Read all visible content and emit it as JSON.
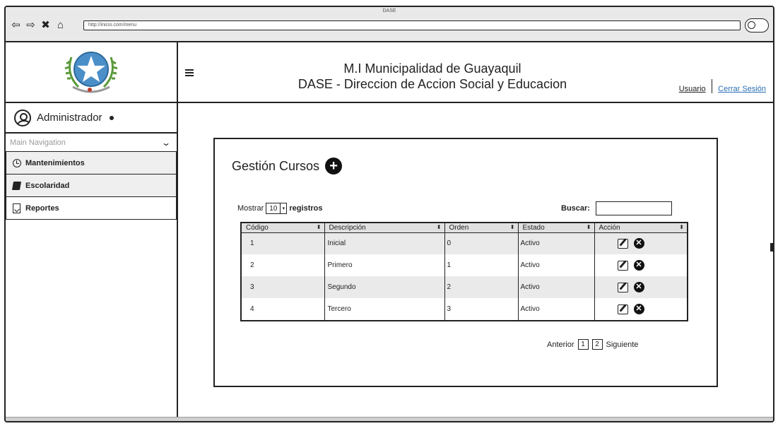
{
  "browser": {
    "window_title": "DASE",
    "url": "http://inicio.com/menu"
  },
  "sidebar": {
    "user_name": "Administrador",
    "main_nav_label": "Main Navigation",
    "items": [
      {
        "label": "Mantenimientos",
        "icon": "clock-icon"
      },
      {
        "label": "Escolaridad",
        "icon": "book-icon"
      },
      {
        "label": "Reportes",
        "icon": "document-icon"
      }
    ]
  },
  "header": {
    "title_line1": "M.I Municipalidad de Guayaquil",
    "title_line2": "DASE - Direccion de Accion Social y Educacion",
    "user_link": "Usuario",
    "logout_link": "Cerrar Sesión"
  },
  "panel": {
    "title": "Gestión Cursos",
    "show_prefix": "Mostrar",
    "show_value": "10",
    "show_suffix": "registros",
    "search_label": "Buscar:",
    "search_value": "",
    "table": {
      "columns": [
        "Código",
        "Descripción",
        "Orden",
        "Estado",
        "Acción"
      ],
      "rows": [
        {
          "codigo": "1",
          "descripcion": "Inicial",
          "orden": "0",
          "estado": "Activo"
        },
        {
          "codigo": "2",
          "descripcion": "Primero",
          "orden": "1",
          "estado": "Activo"
        },
        {
          "codigo": "3",
          "descripcion": "Segundo",
          "orden": "2",
          "estado": "Activo"
        },
        {
          "codigo": "4",
          "descripcion": "Tercero",
          "orden": "3",
          "estado": "Activo"
        }
      ]
    },
    "pagination": {
      "prev_label": "Anterior",
      "pages": [
        "1",
        "2"
      ],
      "next_label": "Siguiente"
    }
  }
}
